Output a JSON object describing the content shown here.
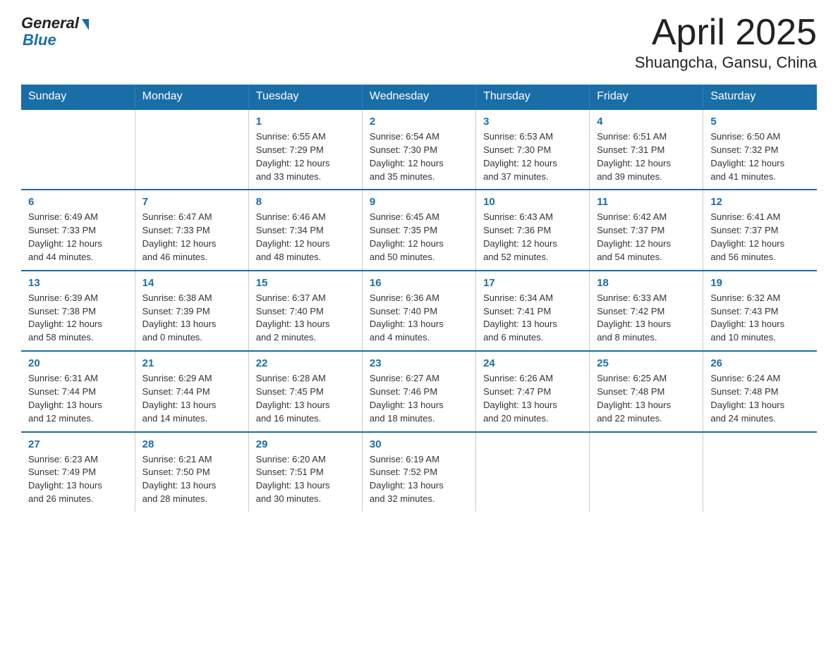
{
  "logo": {
    "general": "General",
    "blue": "Blue"
  },
  "header": {
    "title": "April 2025",
    "location": "Shuangcha, Gansu, China"
  },
  "weekdays": [
    "Sunday",
    "Monday",
    "Tuesday",
    "Wednesday",
    "Thursday",
    "Friday",
    "Saturday"
  ],
  "weeks": [
    [
      {
        "day": "",
        "info": ""
      },
      {
        "day": "",
        "info": ""
      },
      {
        "day": "1",
        "info": "Sunrise: 6:55 AM\nSunset: 7:29 PM\nDaylight: 12 hours\nand 33 minutes."
      },
      {
        "day": "2",
        "info": "Sunrise: 6:54 AM\nSunset: 7:30 PM\nDaylight: 12 hours\nand 35 minutes."
      },
      {
        "day": "3",
        "info": "Sunrise: 6:53 AM\nSunset: 7:30 PM\nDaylight: 12 hours\nand 37 minutes."
      },
      {
        "day": "4",
        "info": "Sunrise: 6:51 AM\nSunset: 7:31 PM\nDaylight: 12 hours\nand 39 minutes."
      },
      {
        "day": "5",
        "info": "Sunrise: 6:50 AM\nSunset: 7:32 PM\nDaylight: 12 hours\nand 41 minutes."
      }
    ],
    [
      {
        "day": "6",
        "info": "Sunrise: 6:49 AM\nSunset: 7:33 PM\nDaylight: 12 hours\nand 44 minutes."
      },
      {
        "day": "7",
        "info": "Sunrise: 6:47 AM\nSunset: 7:33 PM\nDaylight: 12 hours\nand 46 minutes."
      },
      {
        "day": "8",
        "info": "Sunrise: 6:46 AM\nSunset: 7:34 PM\nDaylight: 12 hours\nand 48 minutes."
      },
      {
        "day": "9",
        "info": "Sunrise: 6:45 AM\nSunset: 7:35 PM\nDaylight: 12 hours\nand 50 minutes."
      },
      {
        "day": "10",
        "info": "Sunrise: 6:43 AM\nSunset: 7:36 PM\nDaylight: 12 hours\nand 52 minutes."
      },
      {
        "day": "11",
        "info": "Sunrise: 6:42 AM\nSunset: 7:37 PM\nDaylight: 12 hours\nand 54 minutes."
      },
      {
        "day": "12",
        "info": "Sunrise: 6:41 AM\nSunset: 7:37 PM\nDaylight: 12 hours\nand 56 minutes."
      }
    ],
    [
      {
        "day": "13",
        "info": "Sunrise: 6:39 AM\nSunset: 7:38 PM\nDaylight: 12 hours\nand 58 minutes."
      },
      {
        "day": "14",
        "info": "Sunrise: 6:38 AM\nSunset: 7:39 PM\nDaylight: 13 hours\nand 0 minutes."
      },
      {
        "day": "15",
        "info": "Sunrise: 6:37 AM\nSunset: 7:40 PM\nDaylight: 13 hours\nand 2 minutes."
      },
      {
        "day": "16",
        "info": "Sunrise: 6:36 AM\nSunset: 7:40 PM\nDaylight: 13 hours\nand 4 minutes."
      },
      {
        "day": "17",
        "info": "Sunrise: 6:34 AM\nSunset: 7:41 PM\nDaylight: 13 hours\nand 6 minutes."
      },
      {
        "day": "18",
        "info": "Sunrise: 6:33 AM\nSunset: 7:42 PM\nDaylight: 13 hours\nand 8 minutes."
      },
      {
        "day": "19",
        "info": "Sunrise: 6:32 AM\nSunset: 7:43 PM\nDaylight: 13 hours\nand 10 minutes."
      }
    ],
    [
      {
        "day": "20",
        "info": "Sunrise: 6:31 AM\nSunset: 7:44 PM\nDaylight: 13 hours\nand 12 minutes."
      },
      {
        "day": "21",
        "info": "Sunrise: 6:29 AM\nSunset: 7:44 PM\nDaylight: 13 hours\nand 14 minutes."
      },
      {
        "day": "22",
        "info": "Sunrise: 6:28 AM\nSunset: 7:45 PM\nDaylight: 13 hours\nand 16 minutes."
      },
      {
        "day": "23",
        "info": "Sunrise: 6:27 AM\nSunset: 7:46 PM\nDaylight: 13 hours\nand 18 minutes."
      },
      {
        "day": "24",
        "info": "Sunrise: 6:26 AM\nSunset: 7:47 PM\nDaylight: 13 hours\nand 20 minutes."
      },
      {
        "day": "25",
        "info": "Sunrise: 6:25 AM\nSunset: 7:48 PM\nDaylight: 13 hours\nand 22 minutes."
      },
      {
        "day": "26",
        "info": "Sunrise: 6:24 AM\nSunset: 7:48 PM\nDaylight: 13 hours\nand 24 minutes."
      }
    ],
    [
      {
        "day": "27",
        "info": "Sunrise: 6:23 AM\nSunset: 7:49 PM\nDaylight: 13 hours\nand 26 minutes."
      },
      {
        "day": "28",
        "info": "Sunrise: 6:21 AM\nSunset: 7:50 PM\nDaylight: 13 hours\nand 28 minutes."
      },
      {
        "day": "29",
        "info": "Sunrise: 6:20 AM\nSunset: 7:51 PM\nDaylight: 13 hours\nand 30 minutes."
      },
      {
        "day": "30",
        "info": "Sunrise: 6:19 AM\nSunset: 7:52 PM\nDaylight: 13 hours\nand 32 minutes."
      },
      {
        "day": "",
        "info": ""
      },
      {
        "day": "",
        "info": ""
      },
      {
        "day": "",
        "info": ""
      }
    ]
  ]
}
